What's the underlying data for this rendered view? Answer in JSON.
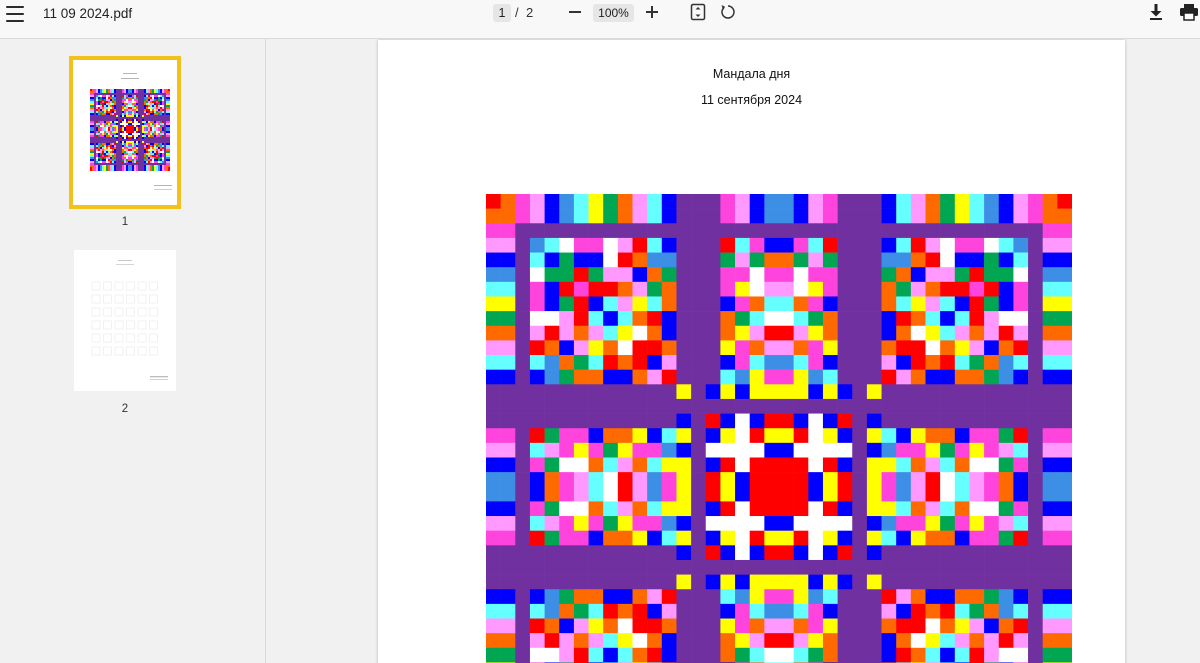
{
  "toolbar": {
    "file_name": "11 09 2024.pdf",
    "current_page": "1",
    "page_separator": "/",
    "total_pages": "2",
    "zoom": "100%",
    "icons": {
      "menu": "hamburger-menu-icon",
      "zoom_out": "minus-icon",
      "zoom_in": "plus-icon",
      "fit": "fit-to-page-icon",
      "rotate": "rotate-icon",
      "download": "download-icon",
      "print": "print-icon"
    }
  },
  "sidebar": {
    "thumbnails": [
      {
        "label": "1",
        "selected": true
      },
      {
        "label": "2",
        "selected": false
      }
    ],
    "selection_color": "#f3c21a"
  },
  "document": {
    "title": "Мандала дня",
    "date": "11 сентября 2024"
  },
  "colors": {
    "red": "#ff0000",
    "orange": "#ff6a00",
    "yellow": "#ffff00",
    "green": "#00a651",
    "cyan": "#66ffff",
    "sky": "#3d8fe6",
    "blue": "#0000ff",
    "pink": "#ff99ff",
    "magenta": "#ff44dd",
    "purple": "#7030a0",
    "white": "#ffffff"
  }
}
